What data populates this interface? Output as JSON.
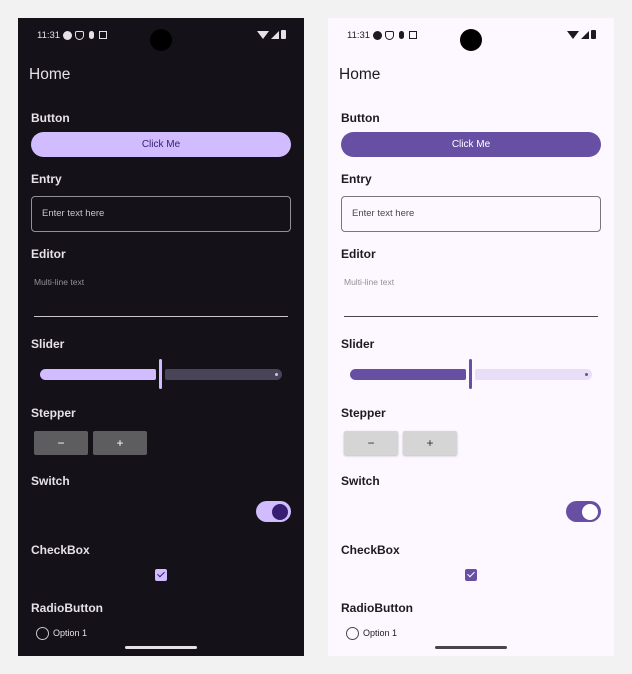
{
  "status": {
    "time": "11:31"
  },
  "page": {
    "title": "Home"
  },
  "button": {
    "section_label": "Button",
    "label": "Click Me"
  },
  "entry": {
    "section_label": "Entry",
    "placeholder": "Enter text here"
  },
  "editor": {
    "section_label": "Editor",
    "placeholder": "Multi-line text"
  },
  "slider": {
    "section_label": "Slider",
    "value_fraction": 0.5
  },
  "stepper": {
    "section_label": "Stepper",
    "minus_label": "−",
    "plus_label": "+"
  },
  "switch": {
    "section_label": "Switch",
    "on": true
  },
  "checkbox": {
    "section_label": "CheckBox",
    "checked": true
  },
  "radio": {
    "section_label": "RadioButton",
    "option1": "Option 1"
  },
  "themes": {
    "dark": {
      "background": "#141218",
      "primary": "#d0bcff",
      "on_primary": "#381e72"
    },
    "light": {
      "background": "#fdf7ff",
      "primary": "#6750a4",
      "on_primary": "#ffffff"
    }
  }
}
